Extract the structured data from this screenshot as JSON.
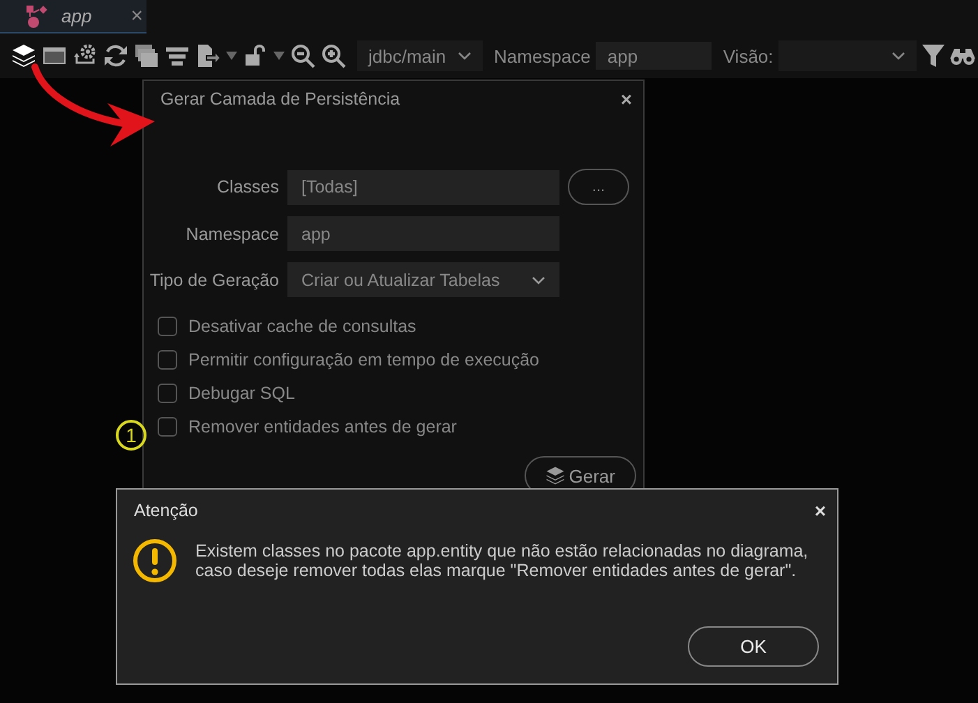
{
  "tab": {
    "title": "app",
    "close": "×",
    "selected": true
  },
  "toolbar": {
    "connection": "jdbc/main",
    "namespace_label": "Namespace",
    "namespace_value": "app",
    "view_label": "Visão:"
  },
  "persistence_dialog": {
    "title": "Gerar Camada de Persistência",
    "close": "×",
    "fields": [
      {
        "label": "Classes",
        "kind": "text",
        "value": "[Todas]"
      },
      {
        "label": "Namespace",
        "kind": "text",
        "value": "app"
      },
      {
        "label": "Tipo de Geração",
        "kind": "select",
        "value": "Criar ou Atualizar Tabelas"
      }
    ],
    "browse_button": "...",
    "options": [
      {
        "label": "Desativar cache de consultas",
        "checked": false
      },
      {
        "label": "Permitir configuração em tempo de execução",
        "checked": false
      },
      {
        "label": "Debugar SQL",
        "checked": false
      },
      {
        "label": "Remover entidades antes de gerar",
        "checked": false
      }
    ],
    "generate_button": "Gerar"
  },
  "annotation": {
    "callout": "1"
  },
  "alert": {
    "title": "Atenção",
    "close": "×",
    "message": "Existem classes no pacote app.entity que não estão relacionadas no diagrama, caso deseje remover todas elas marque \"Remover entidades antes de gerar\".",
    "button": "OK"
  }
}
